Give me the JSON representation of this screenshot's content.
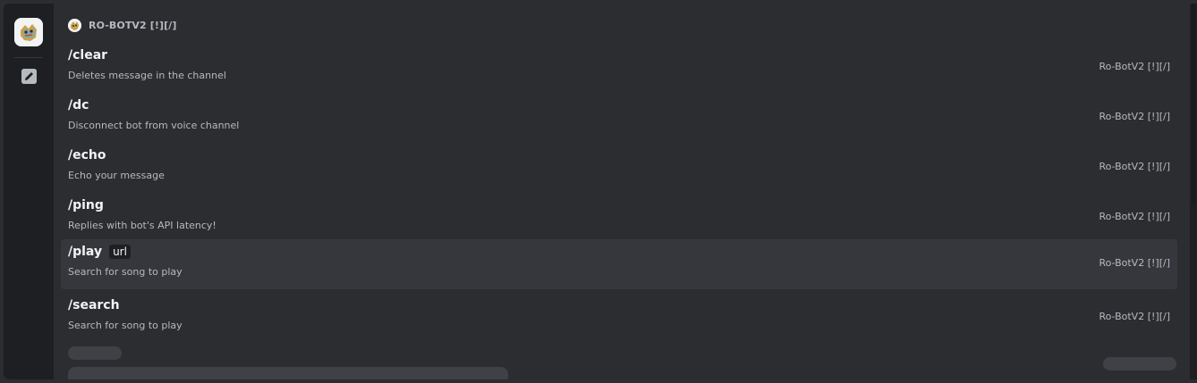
{
  "bot": {
    "name": "RO-BOTV2 [!][/]",
    "avatar_icon": "bot-mascot-icon"
  },
  "rail": {
    "edit_icon": "pencil-icon"
  },
  "commands": [
    {
      "name": "/clear",
      "option": "",
      "description": "Deletes message in the channel",
      "source": "Ro-BotV2 [!][/]",
      "selected": false
    },
    {
      "name": "/dc",
      "option": "",
      "description": "Disconnect bot from voice channel",
      "source": "Ro-BotV2 [!][/]",
      "selected": false
    },
    {
      "name": "/echo",
      "option": "",
      "description": "Echo your message",
      "source": "Ro-BotV2 [!][/]",
      "selected": false
    },
    {
      "name": "/ping",
      "option": "",
      "description": "Replies with bot's API latency!",
      "source": "Ro-BotV2 [!][/]",
      "selected": false
    },
    {
      "name": "/play",
      "option": "url",
      "description": "Search for song to play",
      "source": "Ro-BotV2 [!][/]",
      "selected": true
    },
    {
      "name": "/search",
      "option": "",
      "description": "Search for song to play",
      "source": "Ro-BotV2 [!][/]",
      "selected": false
    }
  ],
  "colors": {
    "background": "#2b2d31",
    "rail": "#1e1f22",
    "selected_row": "#35373c",
    "text_primary": "#f2f3f5",
    "text_muted": "#b5bac1"
  }
}
